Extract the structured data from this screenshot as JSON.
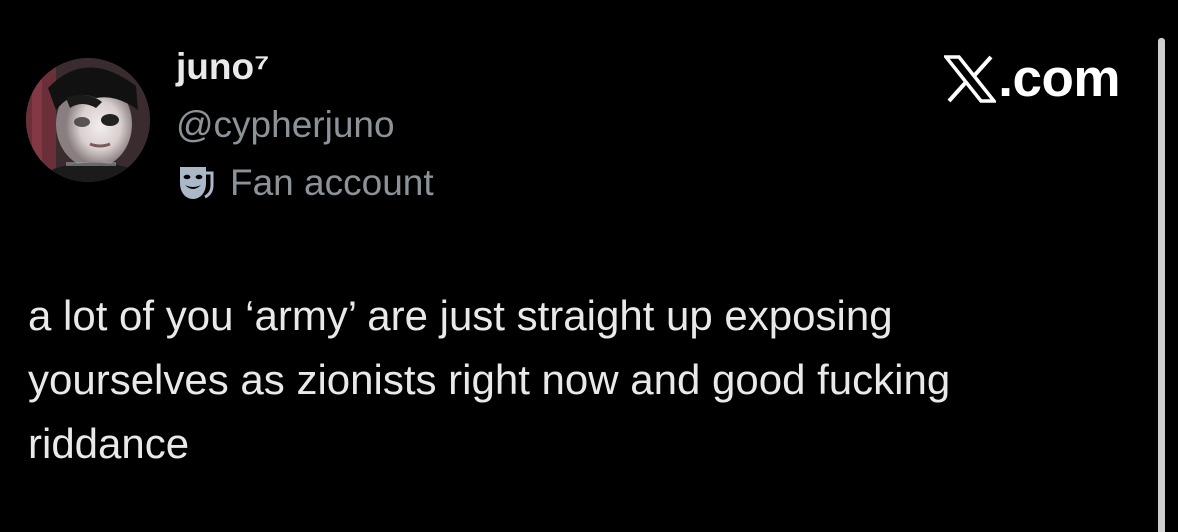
{
  "author": {
    "display_name": "juno⁷",
    "handle": "@cypherjuno",
    "label": "Fan account",
    "label_icon": "theater-masks-icon",
    "avatar_icon": "profile-photo"
  },
  "site": {
    "text": ".com",
    "logo_icon": "x-logo-icon"
  },
  "tweet": {
    "text": "a lot of you ‘army’ are just straight up exposing\nyourselves as zionists right now and good fucking\nriddance"
  },
  "colors": {
    "background": "#000000",
    "primary_text": "#e7e9ea",
    "secondary_text": "#8b9298",
    "label_icon": "#aab8c8"
  }
}
